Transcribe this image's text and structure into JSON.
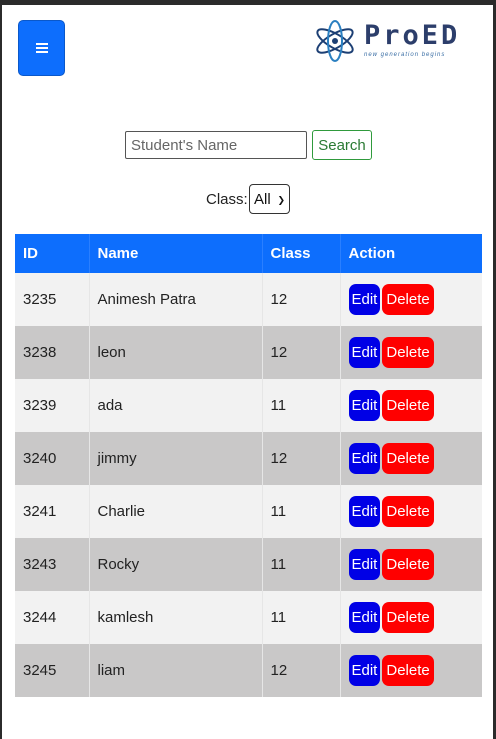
{
  "header": {
    "menu_icon": "hamburger-icon",
    "logo": {
      "name": "ProED",
      "tagline": "new generation begins"
    }
  },
  "search": {
    "placeholder": "Student's Name",
    "button_label": "Search"
  },
  "filter": {
    "label": "Class:",
    "selected": "All"
  },
  "table": {
    "headers": [
      "ID",
      "Name",
      "Class",
      "Action"
    ],
    "edit_label": "Edit",
    "delete_label": "Delete",
    "rows": [
      {
        "id": "3235",
        "name": "Animesh Patra",
        "class": "12"
      },
      {
        "id": "3238",
        "name": "leon",
        "class": "12"
      },
      {
        "id": "3239",
        "name": "ada",
        "class": "11"
      },
      {
        "id": "3240",
        "name": "jimmy",
        "class": "12"
      },
      {
        "id": "3241",
        "name": "Charlie",
        "class": "11"
      },
      {
        "id": "3243",
        "name": "Rocky",
        "class": "11"
      },
      {
        "id": "3244",
        "name": "kamlesh",
        "class": "11"
      },
      {
        "id": "3245",
        "name": "liam",
        "class": "12"
      }
    ]
  },
  "colors": {
    "primary": "#0d6efd",
    "edit": "#0000e6",
    "delete": "#ff0000",
    "search_border": "#2f9a3c",
    "row_odd": "#f2f2f2",
    "row_even": "#c9c8c8"
  }
}
